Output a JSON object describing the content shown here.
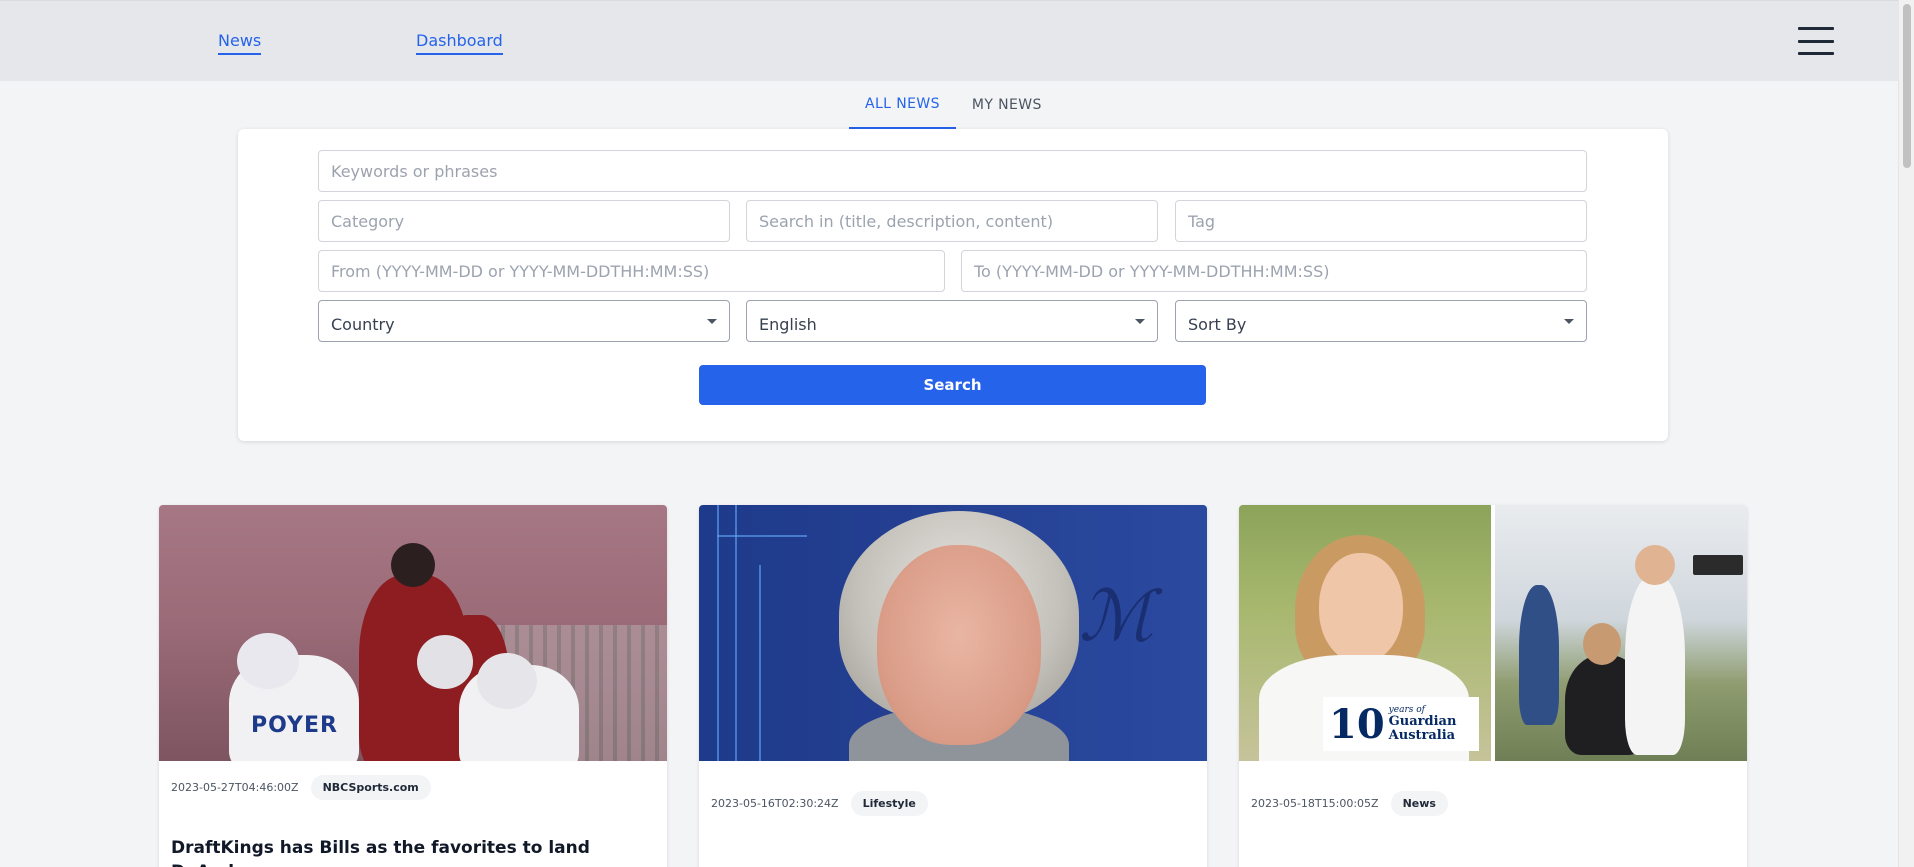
{
  "nav": {
    "news_label": "News",
    "dashboard_label": "Dashboard",
    "menu_icon": "hamburger-menu-icon"
  },
  "tabs": [
    {
      "label": "ALL NEWS",
      "active": true
    },
    {
      "label": "MY NEWS",
      "active": false
    }
  ],
  "search_form": {
    "keywords": {
      "placeholder": "Keywords or phrases",
      "value": ""
    },
    "category": {
      "placeholder": "Category",
      "value": ""
    },
    "search_in": {
      "placeholder": "Search in (title, description, content)",
      "value": ""
    },
    "tag": {
      "placeholder": "Tag",
      "value": ""
    },
    "from": {
      "placeholder": "From (YYYY-MM-DD or YYYY-MM-DDTHH:MM:SS)",
      "value": ""
    },
    "to": {
      "placeholder": "To (YYYY-MM-DD or YYYY-MM-DDTHH:MM:SS)",
      "value": ""
    },
    "country": {
      "selected": "Country"
    },
    "language": {
      "selected": "English"
    },
    "sort_by": {
      "selected": "Sort By"
    },
    "search_button": "Search"
  },
  "colors": {
    "accent": "#2563eb",
    "topbar_bg": "#e5e7eb",
    "page_bg": "#f3f4f6"
  },
  "articles": [
    {
      "date": "2023-05-27T04:46:00Z",
      "source": "NBCSports.com",
      "headline": "DraftKings has Bills as the favorites to land DeAndre",
      "image_text": "POYER"
    },
    {
      "date": "2023-05-16T02:30:24Z",
      "source": "Lifestyle",
      "headline": ""
    },
    {
      "date": "2023-05-18T15:00:05Z",
      "source": "News",
      "headline": "",
      "image_logo": {
        "number": "10",
        "line1": "years of",
        "line2": "Guardian",
        "line3": "Australia"
      }
    }
  ]
}
